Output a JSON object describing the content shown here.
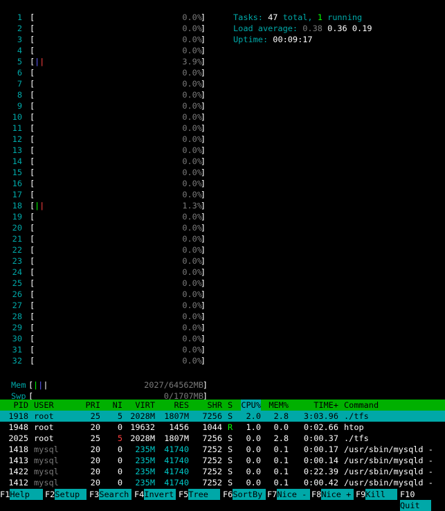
{
  "cpus": [
    {
      "num": "1",
      "pct": "0.0%"
    },
    {
      "num": "2",
      "pct": "0.0%"
    },
    {
      "num": "3",
      "pct": "0.0%"
    },
    {
      "num": "4",
      "pct": "0.0%"
    },
    {
      "num": "5",
      "pct": "3.9%",
      "bar": "||",
      "bar_colors": [
        "blue",
        "red"
      ]
    },
    {
      "num": "6",
      "pct": "0.0%"
    },
    {
      "num": "7",
      "pct": "0.0%"
    },
    {
      "num": "8",
      "pct": "0.0%"
    },
    {
      "num": "9",
      "pct": "0.0%"
    },
    {
      "num": "10",
      "pct": "0.0%"
    },
    {
      "num": "11",
      "pct": "0.0%"
    },
    {
      "num": "12",
      "pct": "0.0%"
    },
    {
      "num": "13",
      "pct": "0.0%"
    },
    {
      "num": "14",
      "pct": "0.0%"
    },
    {
      "num": "15",
      "pct": "0.0%"
    },
    {
      "num": "16",
      "pct": "0.0%"
    },
    {
      "num": "17",
      "pct": "0.0%"
    },
    {
      "num": "18",
      "pct": "1.3%",
      "bar": "||",
      "bar_colors": [
        "green",
        "red"
      ]
    },
    {
      "num": "19",
      "pct": "0.0%"
    },
    {
      "num": "20",
      "pct": "0.0%"
    },
    {
      "num": "21",
      "pct": "0.0%"
    },
    {
      "num": "22",
      "pct": "0.0%"
    },
    {
      "num": "23",
      "pct": "0.0%"
    },
    {
      "num": "24",
      "pct": "0.0%"
    },
    {
      "num": "25",
      "pct": "0.0%"
    },
    {
      "num": "26",
      "pct": "0.0%"
    },
    {
      "num": "27",
      "pct": "0.0%"
    },
    {
      "num": "28",
      "pct": "0.0%"
    },
    {
      "num": "29",
      "pct": "0.0%"
    },
    {
      "num": "30",
      "pct": "0.0%"
    },
    {
      "num": "31",
      "pct": "0.0%"
    },
    {
      "num": "32",
      "pct": "0.0%"
    }
  ],
  "mem": {
    "label": "Mem",
    "bar": "|||",
    "value": "2027/64562MB"
  },
  "swp": {
    "label": "Swp",
    "value": "0/1707MB"
  },
  "summary": {
    "tasks_label": "Tasks:",
    "tasks_total": "47",
    "tasks_total_suffix": " total,",
    "tasks_running": "1",
    "tasks_running_suffix": " running",
    "load_label": "Load average:",
    "load_1": "0.38",
    "load_5": "0.36",
    "load_15": "0.19",
    "uptime_label": "Uptime:",
    "uptime": "00:09:17"
  },
  "columns": [
    "PID",
    "USER",
    "PRI",
    "NI",
    "VIRT",
    "RES",
    "SHR",
    "S",
    "CPU%",
    "MEM%",
    "TIME+",
    "Command"
  ],
  "processes": [
    {
      "pid": "1918",
      "user": "root",
      "pri": "25",
      "ni": "5",
      "virt": "2028M",
      "res": "1807M",
      "shr": "7256",
      "s": "S",
      "cpu": "2.0",
      "mem": "2.8",
      "time": "3:03.96",
      "cmd": "./tfs",
      "selected": true
    },
    {
      "pid": "1948",
      "user": "root",
      "pri": "20",
      "ni": "0",
      "virt": "19632",
      "res": "1456",
      "shr": "1044",
      "s": "R",
      "cpu": "1.0",
      "mem": "0.0",
      "time": "0:02.66",
      "cmd": "htop"
    },
    {
      "pid": "2025",
      "user": "root",
      "pri": "25",
      "ni": "5",
      "virt": "2028M",
      "res": "1807M",
      "shr": "7256",
      "s": "S",
      "cpu": "0.0",
      "mem": "2.8",
      "time": "0:00.37",
      "cmd": "./tfs",
      "ni_red": true
    },
    {
      "pid": "1418",
      "user": "mysql",
      "pri": "20",
      "ni": "0",
      "virt": "235M",
      "res": "41740",
      "shr": "7252",
      "s": "S",
      "cpu": "0.0",
      "mem": "0.1",
      "time": "0:00.17",
      "cmd": "/usr/sbin/mysqld -",
      "thread": true
    },
    {
      "pid": "1413",
      "user": "mysql",
      "pri": "20",
      "ni": "0",
      "virt": "235M",
      "res": "41740",
      "shr": "7252",
      "s": "S",
      "cpu": "0.0",
      "mem": "0.1",
      "time": "0:00.14",
      "cmd": "/usr/sbin/mysqld -",
      "thread": true
    },
    {
      "pid": "1422",
      "user": "mysql",
      "pri": "20",
      "ni": "0",
      "virt": "235M",
      "res": "41740",
      "shr": "7252",
      "s": "S",
      "cpu": "0.0",
      "mem": "0.1",
      "time": "0:22.39",
      "cmd": "/usr/sbin/mysqld -",
      "thread": true
    },
    {
      "pid": "1412",
      "user": "mysql",
      "pri": "20",
      "ni": "0",
      "virt": "235M",
      "res": "41740",
      "shr": "7252",
      "s": "S",
      "cpu": "0.0",
      "mem": "0.1",
      "time": "0:00.42",
      "cmd": "/usr/sbin/mysqld -",
      "thread": true
    }
  ],
  "fkeys": [
    {
      "key": "F1",
      "label": "Help"
    },
    {
      "key": "F2",
      "label": "Setup"
    },
    {
      "key": "F3",
      "label": "Search"
    },
    {
      "key": "F4",
      "label": "Invert"
    },
    {
      "key": "F5",
      "label": "Tree"
    },
    {
      "key": "F6",
      "label": "SortBy"
    },
    {
      "key": "F7",
      "label": "Nice -"
    },
    {
      "key": "F8",
      "label": "Nice +"
    },
    {
      "key": "F9",
      "label": "Kill"
    },
    {
      "key": "F10",
      "label": "Quit"
    }
  ],
  "colors": {
    "header_bg": "#00b000",
    "selected_bg": "#00a8a8",
    "label": "#00a8a8"
  }
}
